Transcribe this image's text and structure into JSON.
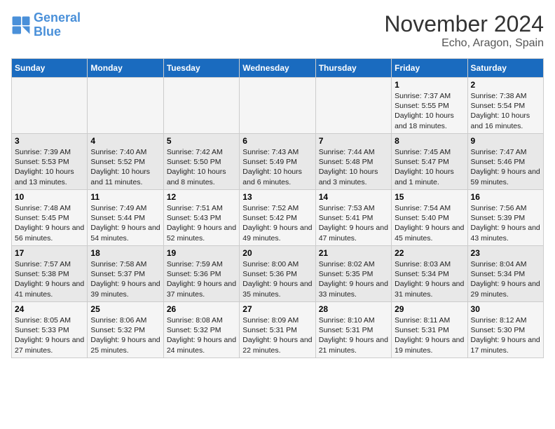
{
  "logo": {
    "text_general": "General",
    "text_blue": "Blue"
  },
  "header": {
    "month": "November 2024",
    "location": "Echo, Aragon, Spain"
  },
  "columns": [
    "Sunday",
    "Monday",
    "Tuesday",
    "Wednesday",
    "Thursday",
    "Friday",
    "Saturday"
  ],
  "weeks": [
    {
      "days": [
        {
          "num": "",
          "info": ""
        },
        {
          "num": "",
          "info": ""
        },
        {
          "num": "",
          "info": ""
        },
        {
          "num": "",
          "info": ""
        },
        {
          "num": "",
          "info": ""
        },
        {
          "num": "1",
          "info": "Sunrise: 7:37 AM\nSunset: 5:55 PM\nDaylight: 10 hours and 18 minutes."
        },
        {
          "num": "2",
          "info": "Sunrise: 7:38 AM\nSunset: 5:54 PM\nDaylight: 10 hours and 16 minutes."
        }
      ]
    },
    {
      "days": [
        {
          "num": "3",
          "info": "Sunrise: 7:39 AM\nSunset: 5:53 PM\nDaylight: 10 hours and 13 minutes."
        },
        {
          "num": "4",
          "info": "Sunrise: 7:40 AM\nSunset: 5:52 PM\nDaylight: 10 hours and 11 minutes."
        },
        {
          "num": "5",
          "info": "Sunrise: 7:42 AM\nSunset: 5:50 PM\nDaylight: 10 hours and 8 minutes."
        },
        {
          "num": "6",
          "info": "Sunrise: 7:43 AM\nSunset: 5:49 PM\nDaylight: 10 hours and 6 minutes."
        },
        {
          "num": "7",
          "info": "Sunrise: 7:44 AM\nSunset: 5:48 PM\nDaylight: 10 hours and 3 minutes."
        },
        {
          "num": "8",
          "info": "Sunrise: 7:45 AM\nSunset: 5:47 PM\nDaylight: 10 hours and 1 minute."
        },
        {
          "num": "9",
          "info": "Sunrise: 7:47 AM\nSunset: 5:46 PM\nDaylight: 9 hours and 59 minutes."
        }
      ]
    },
    {
      "days": [
        {
          "num": "10",
          "info": "Sunrise: 7:48 AM\nSunset: 5:45 PM\nDaylight: 9 hours and 56 minutes."
        },
        {
          "num": "11",
          "info": "Sunrise: 7:49 AM\nSunset: 5:44 PM\nDaylight: 9 hours and 54 minutes."
        },
        {
          "num": "12",
          "info": "Sunrise: 7:51 AM\nSunset: 5:43 PM\nDaylight: 9 hours and 52 minutes."
        },
        {
          "num": "13",
          "info": "Sunrise: 7:52 AM\nSunset: 5:42 PM\nDaylight: 9 hours and 49 minutes."
        },
        {
          "num": "14",
          "info": "Sunrise: 7:53 AM\nSunset: 5:41 PM\nDaylight: 9 hours and 47 minutes."
        },
        {
          "num": "15",
          "info": "Sunrise: 7:54 AM\nSunset: 5:40 PM\nDaylight: 9 hours and 45 minutes."
        },
        {
          "num": "16",
          "info": "Sunrise: 7:56 AM\nSunset: 5:39 PM\nDaylight: 9 hours and 43 minutes."
        }
      ]
    },
    {
      "days": [
        {
          "num": "17",
          "info": "Sunrise: 7:57 AM\nSunset: 5:38 PM\nDaylight: 9 hours and 41 minutes."
        },
        {
          "num": "18",
          "info": "Sunrise: 7:58 AM\nSunset: 5:37 PM\nDaylight: 9 hours and 39 minutes."
        },
        {
          "num": "19",
          "info": "Sunrise: 7:59 AM\nSunset: 5:36 PM\nDaylight: 9 hours and 37 minutes."
        },
        {
          "num": "20",
          "info": "Sunrise: 8:00 AM\nSunset: 5:36 PM\nDaylight: 9 hours and 35 minutes."
        },
        {
          "num": "21",
          "info": "Sunrise: 8:02 AM\nSunset: 5:35 PM\nDaylight: 9 hours and 33 minutes."
        },
        {
          "num": "22",
          "info": "Sunrise: 8:03 AM\nSunset: 5:34 PM\nDaylight: 9 hours and 31 minutes."
        },
        {
          "num": "23",
          "info": "Sunrise: 8:04 AM\nSunset: 5:34 PM\nDaylight: 9 hours and 29 minutes."
        }
      ]
    },
    {
      "days": [
        {
          "num": "24",
          "info": "Sunrise: 8:05 AM\nSunset: 5:33 PM\nDaylight: 9 hours and 27 minutes."
        },
        {
          "num": "25",
          "info": "Sunrise: 8:06 AM\nSunset: 5:32 PM\nDaylight: 9 hours and 25 minutes."
        },
        {
          "num": "26",
          "info": "Sunrise: 8:08 AM\nSunset: 5:32 PM\nDaylight: 9 hours and 24 minutes."
        },
        {
          "num": "27",
          "info": "Sunrise: 8:09 AM\nSunset: 5:31 PM\nDaylight: 9 hours and 22 minutes."
        },
        {
          "num": "28",
          "info": "Sunrise: 8:10 AM\nSunset: 5:31 PM\nDaylight: 9 hours and 21 minutes."
        },
        {
          "num": "29",
          "info": "Sunrise: 8:11 AM\nSunset: 5:31 PM\nDaylight: 9 hours and 19 minutes."
        },
        {
          "num": "30",
          "info": "Sunrise: 8:12 AM\nSunset: 5:30 PM\nDaylight: 9 hours and 17 minutes."
        }
      ]
    }
  ]
}
